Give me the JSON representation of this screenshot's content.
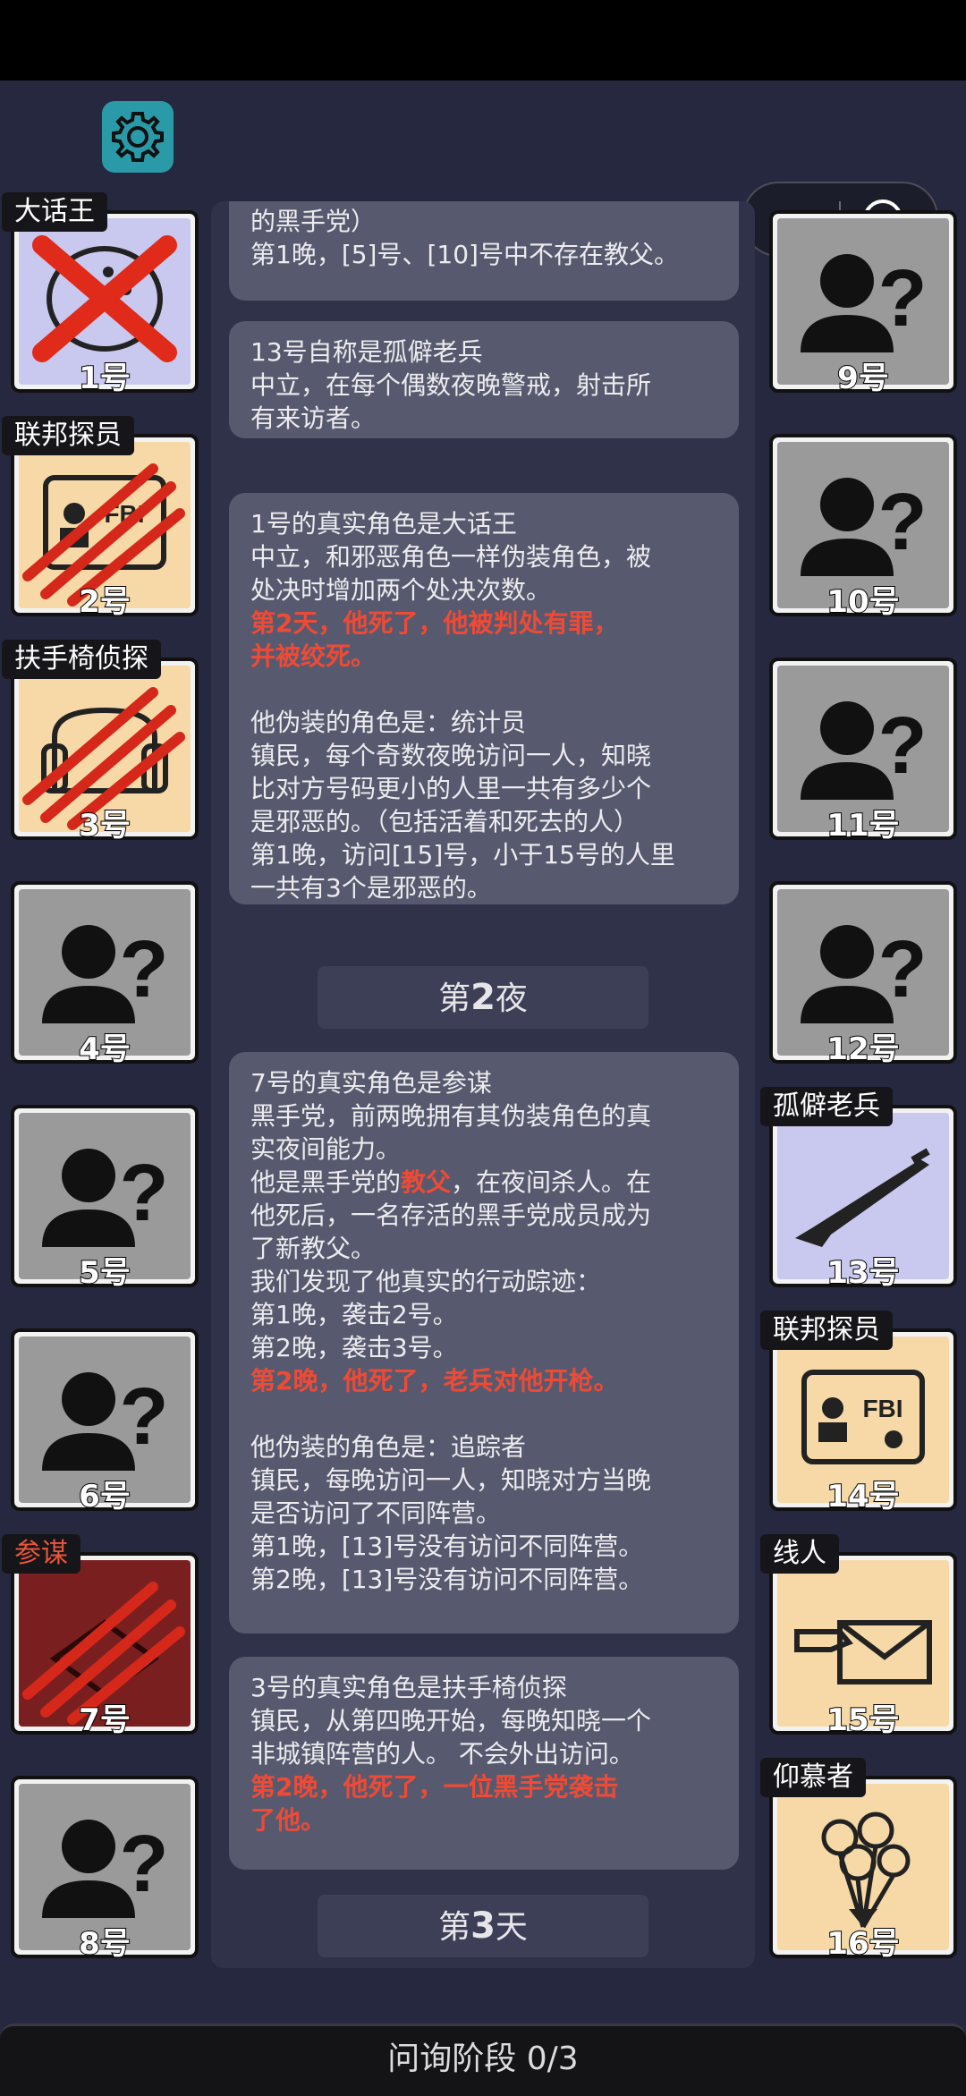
{
  "footer": {
    "stage": "问询阶段 0/3"
  },
  "left_players": [
    {
      "number": "1号",
      "role": "大话王",
      "tag_color": "white",
      "state": "executed",
      "bg": "#c9c8ee"
    },
    {
      "number": "2号",
      "role": "联邦探员",
      "tag_color": "white",
      "state": "killed",
      "bg": "#f6d9a6"
    },
    {
      "number": "3号",
      "role": "扶手椅侦探",
      "tag_color": "white",
      "state": "killed",
      "bg": "#f6d9a6"
    },
    {
      "number": "4号",
      "role": "",
      "state": "unknown",
      "bg": "#9a9a9a"
    },
    {
      "number": "5号",
      "role": "",
      "state": "unknown",
      "bg": "#9a9a9a"
    },
    {
      "number": "6号",
      "role": "",
      "state": "unknown",
      "bg": "#9a9a9a"
    },
    {
      "number": "7号",
      "role": "参谋",
      "tag_color": "red",
      "state": "killed",
      "bg": "#7a1f1f"
    },
    {
      "number": "8号",
      "role": "",
      "state": "unknown",
      "bg": "#9a9a9a"
    }
  ],
  "right_players": [
    {
      "number": "9号",
      "role": "",
      "state": "unknown",
      "bg": "#9a9a9a"
    },
    {
      "number": "10号",
      "role": "",
      "state": "unknown",
      "bg": "#9a9a9a"
    },
    {
      "number": "11号",
      "role": "",
      "state": "unknown",
      "bg": "#9a9a9a"
    },
    {
      "number": "12号",
      "role": "",
      "state": "unknown",
      "bg": "#9a9a9a"
    },
    {
      "number": "13号",
      "role": "孤僻老兵",
      "tag_color": "white",
      "state": "alive",
      "icon": "rifle-icon",
      "bg": "#c9c8ee"
    },
    {
      "number": "14号",
      "role": "联邦探员",
      "tag_color": "white",
      "state": "alive",
      "icon": "fbi-badge-icon",
      "bg": "#f6d9a6"
    },
    {
      "number": "15号",
      "role": "线人",
      "tag_color": "white",
      "state": "alive",
      "icon": "envelope-hand-icon",
      "bg": "#f6d9a6"
    },
    {
      "number": "16号",
      "role": "仰慕者",
      "tag_color": "white",
      "state": "alive",
      "icon": "flowers-icon",
      "bg": "#f6d9a6"
    }
  ],
  "log": {
    "bubble1": [
      "的黑手党）",
      "第1晚，[5]号、[10]号中不存在教父。"
    ],
    "bubble2": [
      "13号自称是孤僻老兵",
      "中立，在每个偶数夜晚警戒，射击所",
      "有来访者。"
    ],
    "bubble3": {
      "lines_a": [
        "1号的真实角色是大话王",
        "中立，和邪恶角色一样伪装角色，被",
        "处决时增加两个处决次数。"
      ],
      "death": [
        "第2天，他死了，他被判处有罪，",
        "并被绞死。"
      ],
      "lines_b": [
        "他伪装的角色是：统计员",
        "镇民，每个奇数夜晚访问一人，知晓",
        "比对方号码更小的人里一共有多少个",
        "是邪恶的。（包括活着和死去的人）",
        "第1晚，访问[15]号，小于15号的人里",
        "一共有3个是邪恶的。"
      ]
    },
    "sep1": {
      "prefix": "第",
      "num": "2",
      "suffix": "夜"
    },
    "bubble4": {
      "lines_a": [
        "7号的真实角色是参谋",
        "黑手党，前两晚拥有其伪装角色的真",
        "实夜间能力。"
      ],
      "godfather_pre": "他是黑手党的",
      "godfather_word": "教父",
      "godfather_post": "，在夜间杀人。在",
      "lines_b": [
        "他死后，一名存活的黑手党成员成为",
        "了新教父。",
        "我们发现了他真实的行动踪迹：",
        "第1晚，袭击2号。",
        "第2晚，袭击3号。"
      ],
      "death": "第2晚，他死了，老兵对他开枪。",
      "lines_c": [
        "他伪装的角色是：追踪者",
        "镇民，每晚访问一人，知晓对方当晚",
        "是否访问了不同阵营。",
        "第1晚，[13]号没有访问不同阵营。",
        "第2晚，[13]号没有访问不同阵营。"
      ]
    },
    "bubble5": {
      "lines_a": [
        "3号的真实角色是扶手椅侦探",
        "镇民，从第四晚开始，每晚知晓一个",
        "非城镇阵营的人。 不会外出访问。"
      ],
      "death": [
        "第2晚，他死了，一位黑手党袭击",
        "了他。"
      ]
    },
    "sep2": {
      "prefix": "第",
      "num": "3",
      "suffix": "天"
    }
  }
}
